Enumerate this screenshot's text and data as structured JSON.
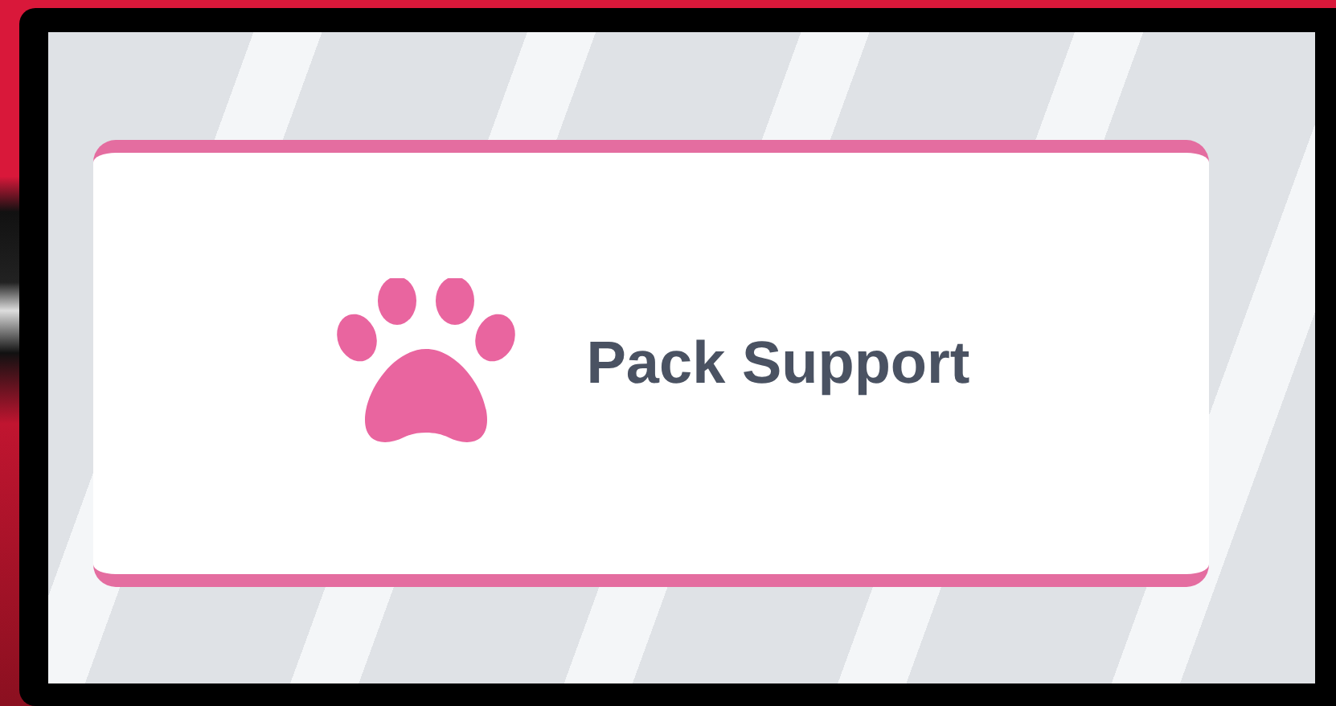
{
  "card": {
    "label": "Pack Support"
  }
}
